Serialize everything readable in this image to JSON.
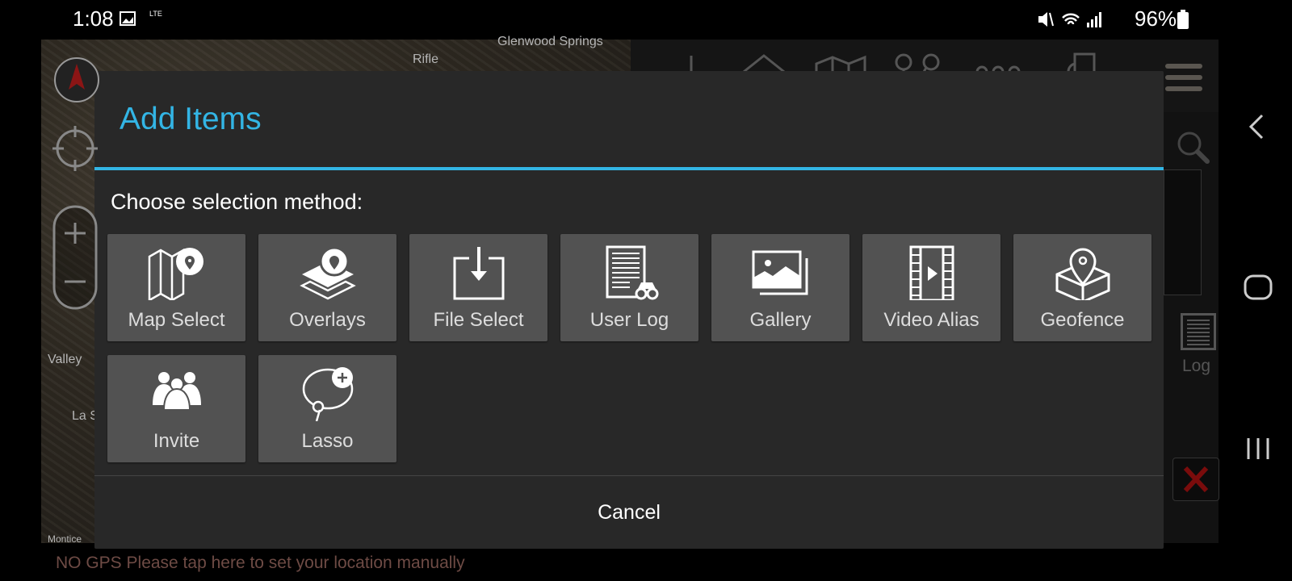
{
  "status_bar": {
    "time": "1:08",
    "network": "LTE",
    "battery": "96%"
  },
  "map": {
    "labels": [
      "Glenwood Springs",
      "Rifle",
      "Valley",
      "La S",
      "Montice"
    ]
  },
  "side_panel": {
    "log_label": "Log"
  },
  "dialog": {
    "title": "Add Items",
    "prompt": "Choose selection method:",
    "items": [
      {
        "label": "Map Select",
        "icon": "map-pin-icon"
      },
      {
        "label": "Overlays",
        "icon": "layers-pin-icon"
      },
      {
        "label": "File Select",
        "icon": "file-download-icon"
      },
      {
        "label": "User Log",
        "icon": "log-binoculars-icon"
      },
      {
        "label": "Gallery",
        "icon": "gallery-icon"
      },
      {
        "label": "Video Alias",
        "icon": "film-icon"
      },
      {
        "label": "Geofence",
        "icon": "geofence-icon"
      },
      {
        "label": "Invite",
        "icon": "users-icon"
      },
      {
        "label": "Lasso",
        "icon": "lasso-plus-icon"
      }
    ],
    "cancel_label": "Cancel"
  },
  "gps_message": "NO GPS Please tap here to set your location manually",
  "colors": {
    "accent": "#33b5e5",
    "tile": "#525252",
    "dialog": "#282828",
    "gps_text": "#6e4b45",
    "close": "#8b0000"
  }
}
